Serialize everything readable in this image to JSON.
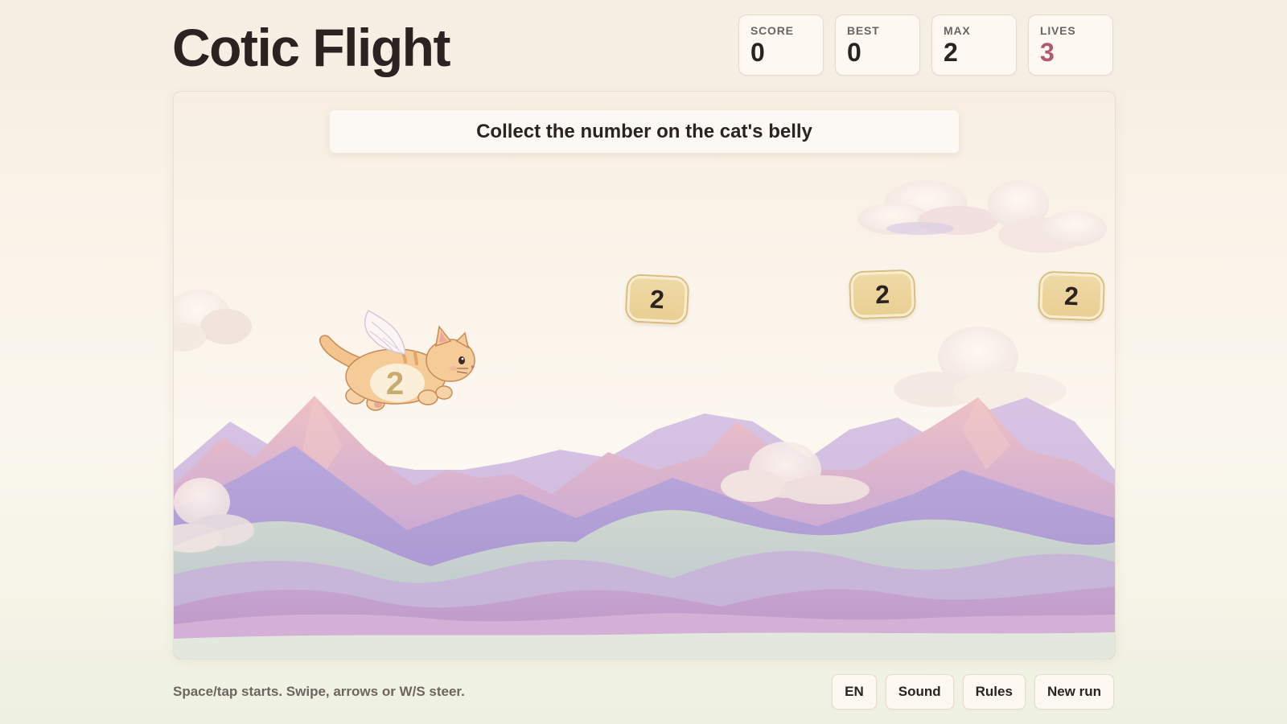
{
  "app": {
    "title": "Cotic Flight"
  },
  "stats": [
    {
      "label": "SCORE",
      "value": "0"
    },
    {
      "label": "BEST",
      "value": "0"
    },
    {
      "label": "MAX",
      "value": "2"
    },
    {
      "label": "LIVES",
      "value": "3"
    }
  ],
  "colors": {
    "lives": "#b05a6d",
    "token_fill": "#ecd49c",
    "mountain_purple": "#a99ad0",
    "mountain_pink": "#e8b9c6"
  },
  "game": {
    "instruction": "Collect the number on the cat's belly",
    "cat_number": "2",
    "tokens": [
      {
        "value": "2"
      },
      {
        "value": "2"
      },
      {
        "value": "2"
      }
    ],
    "icons": [
      "winged-cat-icon",
      "cloud-icon",
      "mountain-icon"
    ]
  },
  "footer": {
    "hint": "Space/tap starts. Swipe, arrows or W/S steer.",
    "buttons": {
      "language": "EN",
      "sound": "Sound",
      "rules": "Rules",
      "new_run": "New run"
    }
  }
}
